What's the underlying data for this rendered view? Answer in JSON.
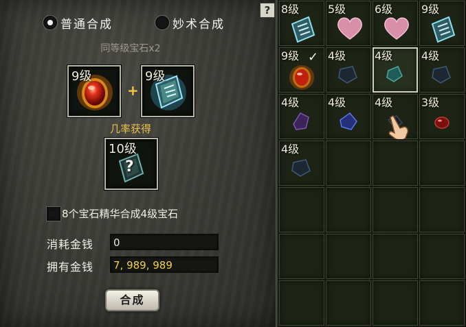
{
  "synthesis": {
    "modes": [
      {
        "label": "普通合成",
        "selected": true
      },
      {
        "label": "妙术合成",
        "selected": false
      }
    ],
    "requirement": "同等级宝石x2",
    "input_slots": [
      {
        "level": "9级",
        "gem": "red-ruby-icon"
      },
      {
        "level": "9级",
        "gem": "blue-rune-stone-icon"
      }
    ],
    "plus": "+",
    "chance_label": "几率获得",
    "result_slot": {
      "level": "10级",
      "gem": "unknown-gem-icon",
      "mark": "?"
    },
    "essence_checkbox": {
      "label": "8个宝石精华合成4级宝石",
      "checked": false
    },
    "cost_label": "消耗金钱",
    "cost_value": "0",
    "own_label": "拥有金钱",
    "own_value": "7, 989, 989",
    "compose_button": "合成",
    "help_button": "?"
  },
  "inventory": {
    "rows": [
      [
        {
          "level": "8级",
          "gem": "blue-rune-stone-icon"
        },
        {
          "level": "5级",
          "gem": "pink-heart-gem-icon"
        },
        {
          "level": "6级",
          "gem": "pink-heart-gem-icon"
        },
        {
          "level": "9级",
          "gem": "blue-rune-stone-icon"
        }
      ],
      [
        {
          "level": "9级",
          "gem": "red-ruby-icon",
          "mark": "✓"
        },
        {
          "level": "4级",
          "gem": "dark-blue-gem-icon"
        },
        {
          "level": "4级",
          "gem": "teal-gem-icon",
          "selected": true
        },
        {
          "level": "4级",
          "gem": "dark-blue-gem-icon"
        }
      ],
      [
        {
          "level": "4级",
          "gem": "purple-gem-icon"
        },
        {
          "level": "4级",
          "gem": "blue-gem-icon"
        },
        {
          "level": "4级",
          "gem": "dark-gem-icon",
          "cursor": "hand-cursor-icon"
        },
        {
          "level": "3级",
          "gem": "small-red-gem-icon"
        }
      ],
      [
        {
          "level": "4级",
          "gem": "dark-blue-gem-icon"
        },
        {},
        {},
        {}
      ],
      [
        {},
        {},
        {},
        {}
      ],
      [
        {},
        {},
        {},
        {}
      ],
      [
        {},
        {},
        {},
        {}
      ]
    ]
  },
  "colors": {
    "gold_text": "#f0d24a",
    "chance_text": "#e9c04a",
    "plus": "#f2c640",
    "slot_border": "#b9b8a5"
  }
}
